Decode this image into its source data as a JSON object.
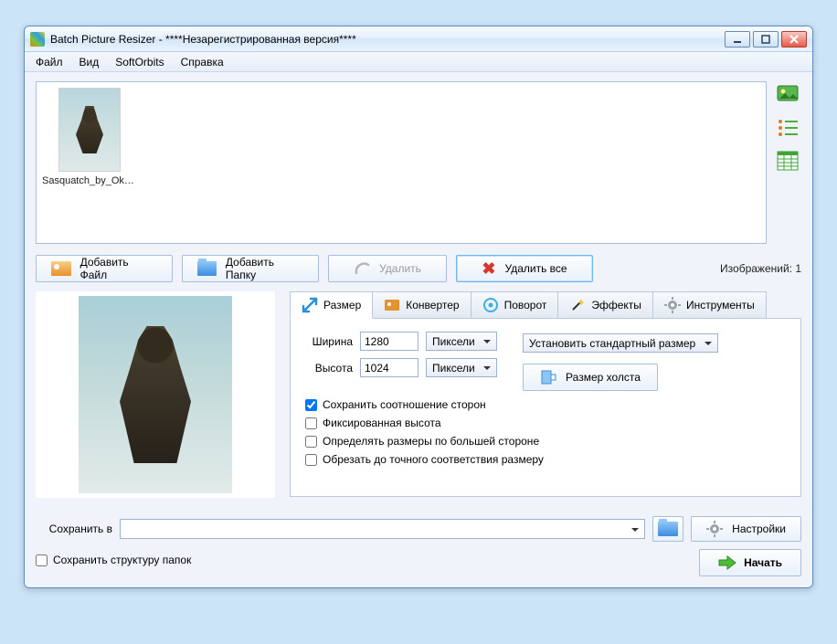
{
  "window": {
    "title": "Batch Picture Resizer - ****Незарегистрированная версия****"
  },
  "menu": {
    "file": "Файл",
    "view": "Вид",
    "softorbits": "SoftOrbits",
    "help": "Справка"
  },
  "thumbnails": {
    "item0_label": "Sasquatch_by_Okmer..."
  },
  "toolbar": {
    "add_file": "Добавить Файл",
    "add_folder": "Добавить Папку",
    "delete": "Удалить",
    "delete_all": "Удалить все",
    "count_label": "Изображений: 1"
  },
  "tabs": {
    "size": "Размер",
    "converter": "Конвертер",
    "rotate": "Поворот",
    "effects": "Эффекты",
    "tools": "Инструменты"
  },
  "size_panel": {
    "width_label": "Ширина",
    "width_value": "1280",
    "width_unit": "Пиксели",
    "height_label": "Высота",
    "height_value": "1024",
    "height_unit": "Пиксели",
    "std_size": "Установить стандартный размер",
    "canvas_size": "Размер холста",
    "keep_ratio": "Сохранить соотношение сторон",
    "fixed_height": "Фиксированная высота",
    "by_larger_side": "Определять размеры по большей стороне",
    "crop_exact": "Обрезать до точного соответствия размеру"
  },
  "bottom": {
    "save_to": "Сохранить в",
    "settings": "Настройки",
    "keep_folders": "Сохранить структуру папок",
    "start": "Начать"
  }
}
